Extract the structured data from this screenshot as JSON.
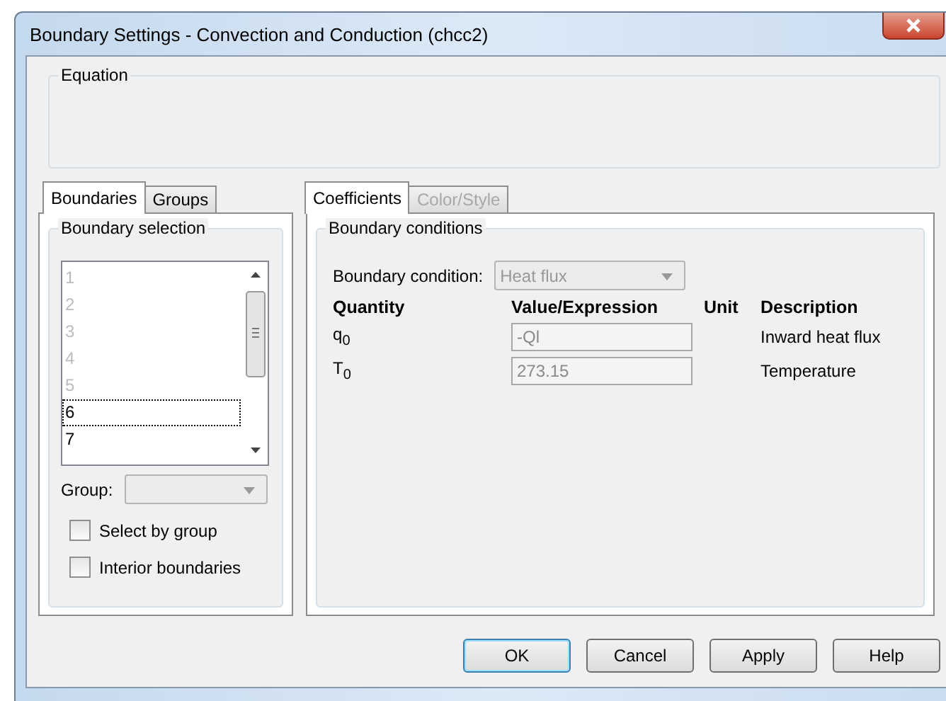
{
  "window": {
    "title": "Boundary Settings - Convection and Conduction (chcc2)"
  },
  "equation": {
    "label": "Equation"
  },
  "left_tabs": [
    {
      "label": "Boundaries",
      "selected": true
    },
    {
      "label": "Groups",
      "selected": false
    }
  ],
  "boundary_selection": {
    "label": "Boundary selection",
    "items": [
      {
        "label": "1",
        "enabled": false,
        "focused": false
      },
      {
        "label": "2",
        "enabled": false,
        "focused": false
      },
      {
        "label": "3",
        "enabled": false,
        "focused": false
      },
      {
        "label": "4",
        "enabled": false,
        "focused": false
      },
      {
        "label": "5",
        "enabled": false,
        "focused": false
      },
      {
        "label": "6",
        "enabled": true,
        "focused": true
      },
      {
        "label": "7",
        "enabled": true,
        "focused": false
      }
    ],
    "group": {
      "label": "Group:",
      "disabled": true
    },
    "checkboxes": [
      {
        "label": "Select by group",
        "checked": false
      },
      {
        "label": "Interior boundaries",
        "checked": false
      }
    ]
  },
  "right_tabs": [
    {
      "label": "Coefficients",
      "selected": true,
      "disabled": false
    },
    {
      "label": "Color/Style",
      "selected": false,
      "disabled": true
    }
  ],
  "boundary_conditions": {
    "label": "Boundary conditions",
    "condition_label": "Boundary condition:",
    "condition_value": "Heat flux",
    "condition_disabled": true,
    "columns": [
      "Quantity",
      "Value/Expression",
      "Unit",
      "Description"
    ],
    "rows": [
      {
        "quantity": "q$_{0}$",
        "value": "-Ql",
        "disabled": true,
        "description": "Inward heat flux"
      },
      {
        "quantity": "T$_{0}$",
        "value": "273.15",
        "disabled": true,
        "description": "Temperature"
      }
    ]
  },
  "buttons": [
    {
      "label": "OK",
      "default": true
    },
    {
      "label": "Cancel",
      "default": false
    },
    {
      "label": "Apply",
      "default": false
    },
    {
      "label": "Help",
      "default": false
    }
  ]
}
